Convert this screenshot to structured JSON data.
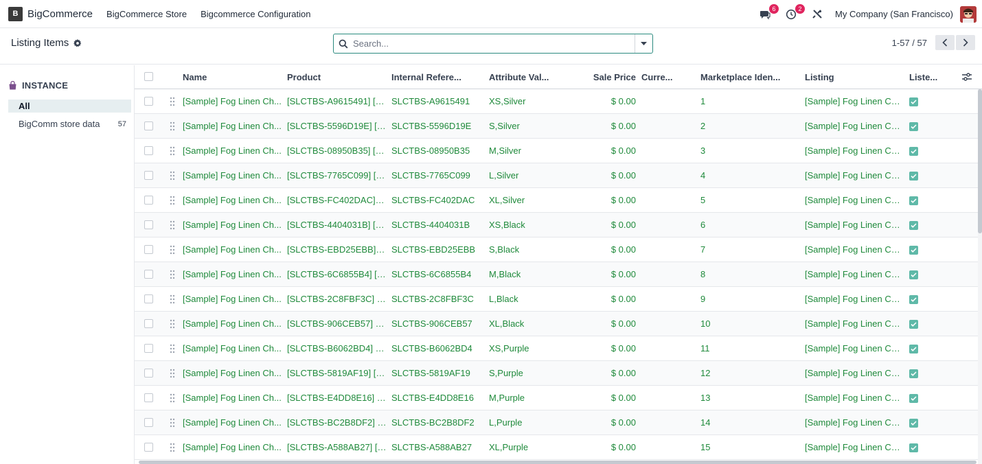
{
  "nav": {
    "app_name": "BigCommerce",
    "logo_letter": "B",
    "menus": [
      "BigCommerce Store",
      "Bigcommerce Configuration"
    ],
    "messages_count": "6",
    "activities_count": "2",
    "company": "My Company (San Francisco)"
  },
  "control": {
    "title": "Listing Items",
    "search_placeholder": "Search...",
    "pager": "1-57 / 57"
  },
  "sidebar": {
    "header": "INSTANCE",
    "items": [
      {
        "label": "All",
        "count": ""
      },
      {
        "label": "BigComm store data",
        "count": "57"
      }
    ]
  },
  "columns": [
    "Name",
    "Product",
    "Internal Refere...",
    "Attribute Val...",
    "Sale Price",
    "Curre...",
    "Marketplace Iden...",
    "Listing",
    "Liste..."
  ],
  "rows": [
    {
      "name": "[Sample] Fog Linen Ch...",
      "product": "[SLCTBS-A9615491] [S...",
      "ref": "SLCTBS-A9615491",
      "attr": "XS,Silver",
      "price": "$ 0.00",
      "mid": "1",
      "listing": "[Sample] Fog Linen Ch..."
    },
    {
      "name": "[Sample] Fog Linen Ch...",
      "product": "[SLCTBS-5596D19E] [S...",
      "ref": "SLCTBS-5596D19E",
      "attr": "S,Silver",
      "price": "$ 0.00",
      "mid": "2",
      "listing": "[Sample] Fog Linen Ch..."
    },
    {
      "name": "[Sample] Fog Linen Ch...",
      "product": "[SLCTBS-08950B35] [S...",
      "ref": "SLCTBS-08950B35",
      "attr": "M,Silver",
      "price": "$ 0.00",
      "mid": "3",
      "listing": "[Sample] Fog Linen Ch..."
    },
    {
      "name": "[Sample] Fog Linen Ch...",
      "product": "[SLCTBS-7765C099] [S...",
      "ref": "SLCTBS-7765C099",
      "attr": "L,Silver",
      "price": "$ 0.00",
      "mid": "4",
      "listing": "[Sample] Fog Linen Ch..."
    },
    {
      "name": "[Sample] Fog Linen Ch...",
      "product": "[SLCTBS-FC402DAC] [S...",
      "ref": "SLCTBS-FC402DAC",
      "attr": "XL,Silver",
      "price": "$ 0.00",
      "mid": "5",
      "listing": "[Sample] Fog Linen Ch..."
    },
    {
      "name": "[Sample] Fog Linen Ch...",
      "product": "[SLCTBS-4404031B] [S...",
      "ref": "SLCTBS-4404031B",
      "attr": "XS,Black",
      "price": "$ 0.00",
      "mid": "6",
      "listing": "[Sample] Fog Linen Ch..."
    },
    {
      "name": "[Sample] Fog Linen Ch...",
      "product": "[SLCTBS-EBD25EBB] [S...",
      "ref": "SLCTBS-EBD25EBB",
      "attr": "S,Black",
      "price": "$ 0.00",
      "mid": "7",
      "listing": "[Sample] Fog Linen Ch..."
    },
    {
      "name": "[Sample] Fog Linen Ch...",
      "product": "[SLCTBS-6C6855B4] [S...",
      "ref": "SLCTBS-6C6855B4",
      "attr": "M,Black",
      "price": "$ 0.00",
      "mid": "8",
      "listing": "[Sample] Fog Linen Ch..."
    },
    {
      "name": "[Sample] Fog Linen Ch...",
      "product": "[SLCTBS-2C8FBF3C] [S...",
      "ref": "SLCTBS-2C8FBF3C",
      "attr": "L,Black",
      "price": "$ 0.00",
      "mid": "9",
      "listing": "[Sample] Fog Linen Ch..."
    },
    {
      "name": "[Sample] Fog Linen Ch...",
      "product": "[SLCTBS-906CEB57] [S...",
      "ref": "SLCTBS-906CEB57",
      "attr": "XL,Black",
      "price": "$ 0.00",
      "mid": "10",
      "listing": "[Sample] Fog Linen Ch..."
    },
    {
      "name": "[Sample] Fog Linen Ch...",
      "product": "[SLCTBS-B6062BD4] [S...",
      "ref": "SLCTBS-B6062BD4",
      "attr": "XS,Purple",
      "price": "$ 0.00",
      "mid": "11",
      "listing": "[Sample] Fog Linen Ch..."
    },
    {
      "name": "[Sample] Fog Linen Ch...",
      "product": "[SLCTBS-5819AF19] [S...",
      "ref": "SLCTBS-5819AF19",
      "attr": "S,Purple",
      "price": "$ 0.00",
      "mid": "12",
      "listing": "[Sample] Fog Linen Ch..."
    },
    {
      "name": "[Sample] Fog Linen Ch...",
      "product": "[SLCTBS-E4DD8E16] [S...",
      "ref": "SLCTBS-E4DD8E16",
      "attr": "M,Purple",
      "price": "$ 0.00",
      "mid": "13",
      "listing": "[Sample] Fog Linen Ch..."
    },
    {
      "name": "[Sample] Fog Linen Ch...",
      "product": "[SLCTBS-BC2B8DF2] [S...",
      "ref": "SLCTBS-BC2B8DF2",
      "attr": "L,Purple",
      "price": "$ 0.00",
      "mid": "14",
      "listing": "[Sample] Fog Linen Ch..."
    },
    {
      "name": "[Sample] Fog Linen Ch...",
      "product": "[SLCTBS-A588AB27] [S...",
      "ref": "SLCTBS-A588AB27",
      "attr": "XL,Purple",
      "price": "$ 0.00",
      "mid": "15",
      "listing": "[Sample] Fog Linen Ch..."
    }
  ],
  "colors": {
    "link": "#017e84",
    "green_text": "#1f8a3b",
    "badge": "#e0245e",
    "checked": "#5fb9a8"
  }
}
